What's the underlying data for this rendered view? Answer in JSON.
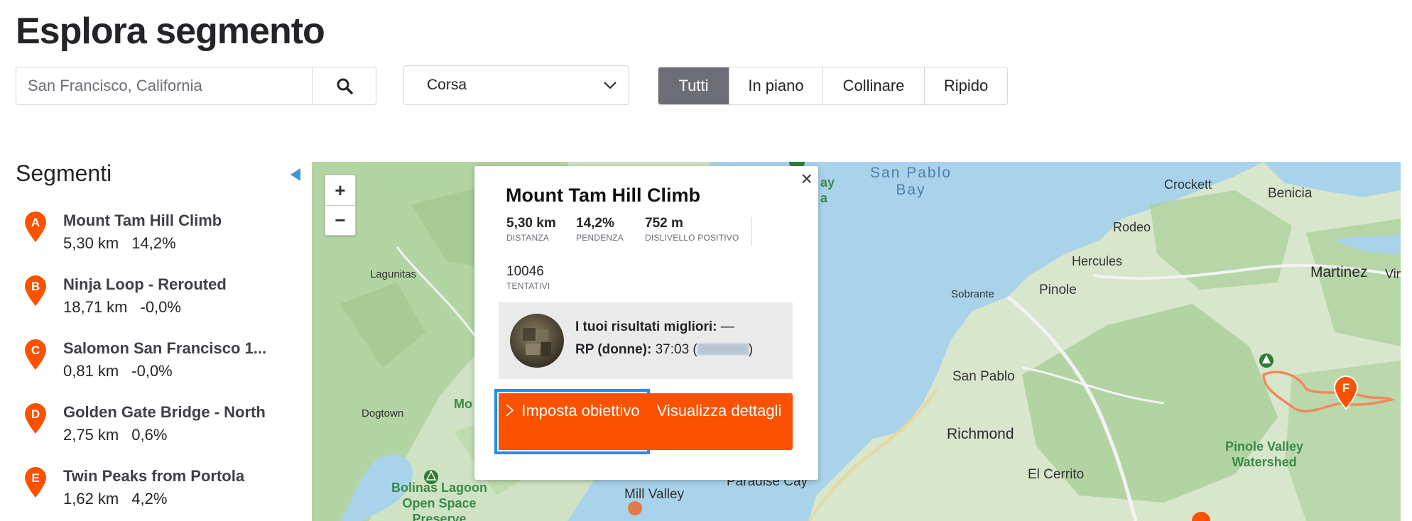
{
  "page": {
    "title": "Esplora segmento"
  },
  "search": {
    "value": "San Francisco, California",
    "button_icon": "search-icon"
  },
  "sport_select": {
    "selected": "Corsa",
    "icon": "chevron-down-icon"
  },
  "terrain_filters": [
    {
      "label": "Tutti",
      "active": true
    },
    {
      "label": "In piano",
      "active": false
    },
    {
      "label": "Collinare",
      "active": false
    },
    {
      "label": "Ripido",
      "active": false
    }
  ],
  "sidebar": {
    "heading": "Segmenti",
    "segments": [
      {
        "marker": "A",
        "name": "Mount Tam Hill Climb",
        "distance": "5,30 km",
        "grade": "14,2%"
      },
      {
        "marker": "B",
        "name": "Ninja Loop - Rerouted",
        "distance": "18,71 km",
        "grade": "-0,0%"
      },
      {
        "marker": "C",
        "name": "Salomon San Francisco 1...",
        "distance": "0,81 km",
        "grade": "-0,0%"
      },
      {
        "marker": "D",
        "name": "Golden Gate Bridge - North",
        "distance": "2,75 km",
        "grade": "0,6%"
      },
      {
        "marker": "E",
        "name": "Twin Peaks from Portola",
        "distance": "1,62 km",
        "grade": "4,2%"
      }
    ]
  },
  "map": {
    "zoom_in": "+",
    "zoom_out": "−",
    "labels": {
      "san_pablo_bay": "San Pablo\nBay",
      "crockett": "Crockett",
      "benicia": "Benicia",
      "rodeo": "Rodeo",
      "hercules": "Hercules",
      "martinez": "Martinez",
      "vine": "Vin",
      "sobrante": "Sobrante",
      "pinole": "Pinole",
      "lagunitas": "Lagunitas",
      "san_pablo": "San Pablo",
      "richmond": "Richmond",
      "dogtown": "Dogtown",
      "el_cerrito": "El Cerrito",
      "pinole_valley": "Pinole Valley\nWatershed",
      "bolinas": "Bolinas Lagoon\nOpen Space\nPreserve",
      "mill_valley": "Mill Valley",
      "paradise_cay": "Paradise Cay",
      "mo_partial": "Mo",
      "ay_partial": "ay",
      "a_partial": "a"
    },
    "marker_f": "F"
  },
  "popup": {
    "close_icon": "×",
    "title": "Mount Tam Hill Climb",
    "stats": [
      {
        "value": "5,30 km",
        "label": "DISTANZA"
      },
      {
        "value": "14,2%",
        "label": "PENDENZA"
      },
      {
        "value": "752 m",
        "label": "DISLIVELLO POSITIVO"
      }
    ],
    "attempts": {
      "value": "10046",
      "label": "TENTATIVI"
    },
    "results": {
      "best_label": "I tuoi risultati migliori:",
      "best_value": " —",
      "pr_label": "RP (donne):",
      "pr_value": " 37:03 ("
    },
    "goal_button": "Imposta obiettivo",
    "details_button": "Visualizza dettagli"
  },
  "colors": {
    "accent": "#fc5200",
    "focus_ring": "#1f8ef1",
    "water": "#a9d3ea",
    "active_filter": "#6d6d78"
  }
}
